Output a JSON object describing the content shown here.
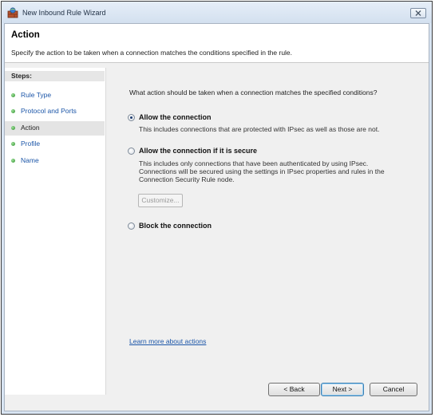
{
  "window": {
    "title": "New Inbound Rule Wizard",
    "close_glyph": "✕",
    "icon": "firewall-shield-icon"
  },
  "header": {
    "title": "Action",
    "subtitle": "Specify the action to be taken when a connection matches the conditions specified in the rule."
  },
  "steps": {
    "heading": "Steps:",
    "items": [
      {
        "label": "Rule Type",
        "current": false
      },
      {
        "label": "Protocol and Ports",
        "current": false
      },
      {
        "label": "Action",
        "current": true
      },
      {
        "label": "Profile",
        "current": false
      },
      {
        "label": "Name",
        "current": false
      }
    ]
  },
  "main": {
    "question": "What action should be taken when a connection matches the specified conditions?",
    "options": [
      {
        "label": "Allow the connection",
        "description": "This includes connections that are protected with IPsec as well as those are not.",
        "selected": true
      },
      {
        "label": "Allow the connection if it is secure",
        "description": "This includes only connections that have been authenticated by using IPsec.  Connections will be secured using the settings in IPsec properties and rules in the Connection Security Rule node.",
        "selected": false
      },
      {
        "label": "Block the connection",
        "description": "",
        "selected": false
      }
    ],
    "customize_label": "Customize...",
    "learn_more": "Learn more about actions"
  },
  "buttons": {
    "back": "< Back",
    "next": "Next >",
    "cancel": "Cancel"
  }
}
